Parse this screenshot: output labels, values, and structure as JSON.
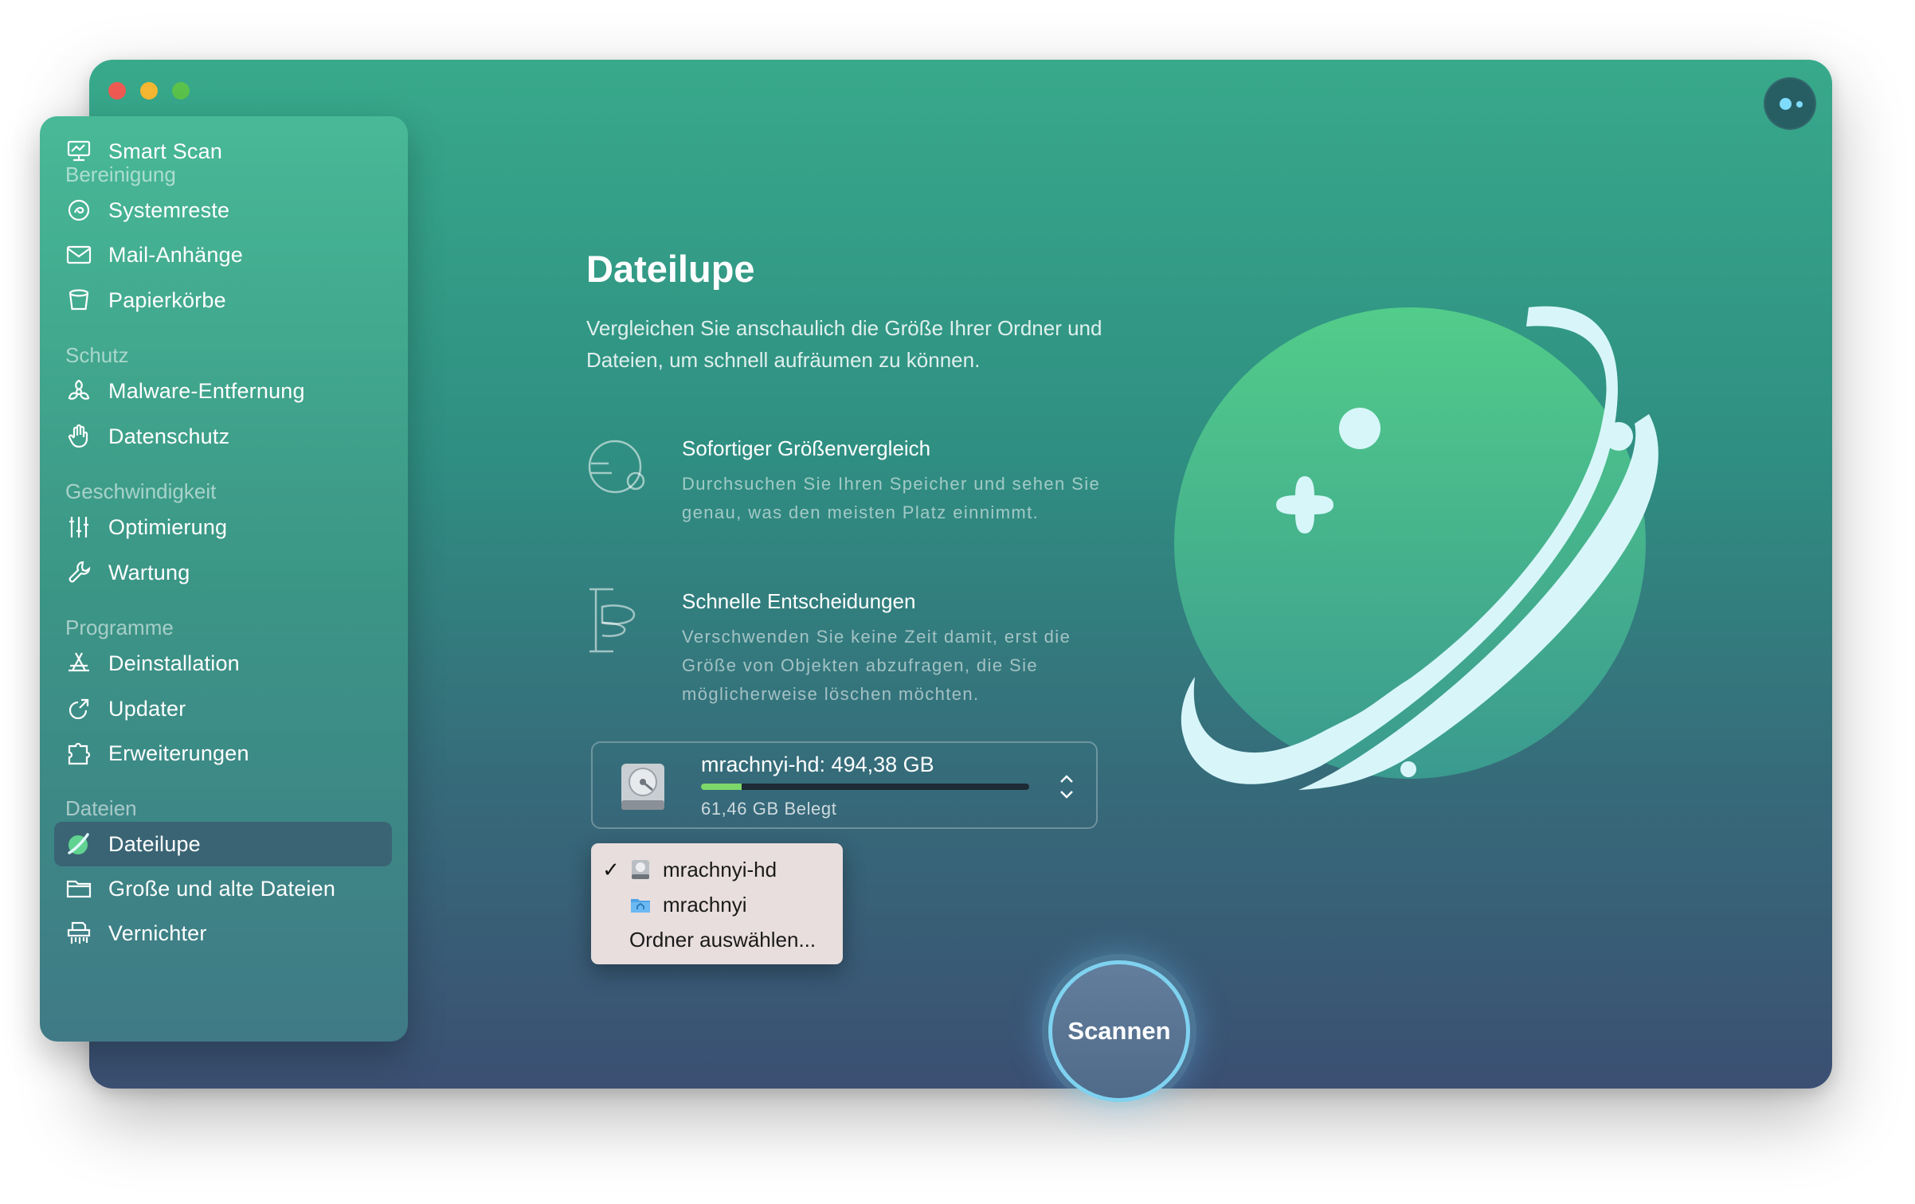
{
  "sidebar": {
    "top_item": {
      "label": "Smart Scan",
      "icon": "monitor-icon"
    },
    "sections": {
      "cleanup": "Bereinigung",
      "protection": "Schutz",
      "speed": "Geschwindigkeit",
      "apps": "Programme",
      "files": "Dateien"
    },
    "items": {
      "system_junk": {
        "label": "Systemreste",
        "icon": "system-junk-icon"
      },
      "mail": {
        "label": "Mail-Anhänge",
        "icon": "envelope-icon"
      },
      "trash": {
        "label": "Papierkörbe",
        "icon": "trash-bin-icon"
      },
      "malware": {
        "label": "Malware-Entfernung",
        "icon": "biohazard-icon"
      },
      "privacy": {
        "label": "Datenschutz",
        "icon": "hand-icon"
      },
      "optimization": {
        "label": "Optimierung",
        "icon": "sliders-icon"
      },
      "maintenance": {
        "label": "Wartung",
        "icon": "wrench-icon"
      },
      "uninstaller": {
        "label": "Deinstallation",
        "icon": "app-store-icon"
      },
      "updater": {
        "label": "Updater",
        "icon": "update-arrow-icon"
      },
      "extensions": {
        "label": "Erweiterungen",
        "icon": "puzzle-icon"
      },
      "space_lens": {
        "label": "Dateilupe",
        "icon": "space-lens-icon",
        "active": true
      },
      "large_old": {
        "label": "Große und alte Dateien",
        "icon": "folder-icon"
      },
      "shredder": {
        "label": "Vernichter",
        "icon": "shredder-icon"
      }
    }
  },
  "main": {
    "title": "Dateilupe",
    "subtitle": "Vergleichen Sie anschaulich die Größe Ihrer Ordner und Dateien, um schnell aufräumen zu können.",
    "features": [
      {
        "title": "Sofortiger Größenvergleich",
        "description": "Durchsuchen Sie Ihren Speicher und sehen Sie genau, was den meisten Platz einnimmt.",
        "icon": "size-compare-icon"
      },
      {
        "title": "Schnelle Entscheidungen",
        "description": "Verschwenden Sie keine Zeit damit, erst die Größe von Objekten abzufragen, die Sie möglicherweise löschen möchten.",
        "icon": "quick-decision-icon"
      }
    ]
  },
  "disk": {
    "name": "mrachnyi-hd: 494,38 GB",
    "used": "61,46 GB Belegt",
    "used_fraction": 0.124,
    "fill_color": "#7dd86a"
  },
  "dropdown": {
    "items": [
      {
        "label": "mrachnyi-hd",
        "checked": true,
        "icon": "hard-drive-icon"
      },
      {
        "label": "mrachnyi",
        "checked": false,
        "icon": "home-folder-icon"
      },
      {
        "label": "Ordner auswählen...",
        "checked": false
      }
    ],
    "check_glyph": "✓"
  },
  "scan_button": {
    "label": "Scannen"
  },
  "colors": {
    "accent": "#7fd2f0",
    "planet": "#45b987",
    "ring": "#d8f6fa"
  }
}
